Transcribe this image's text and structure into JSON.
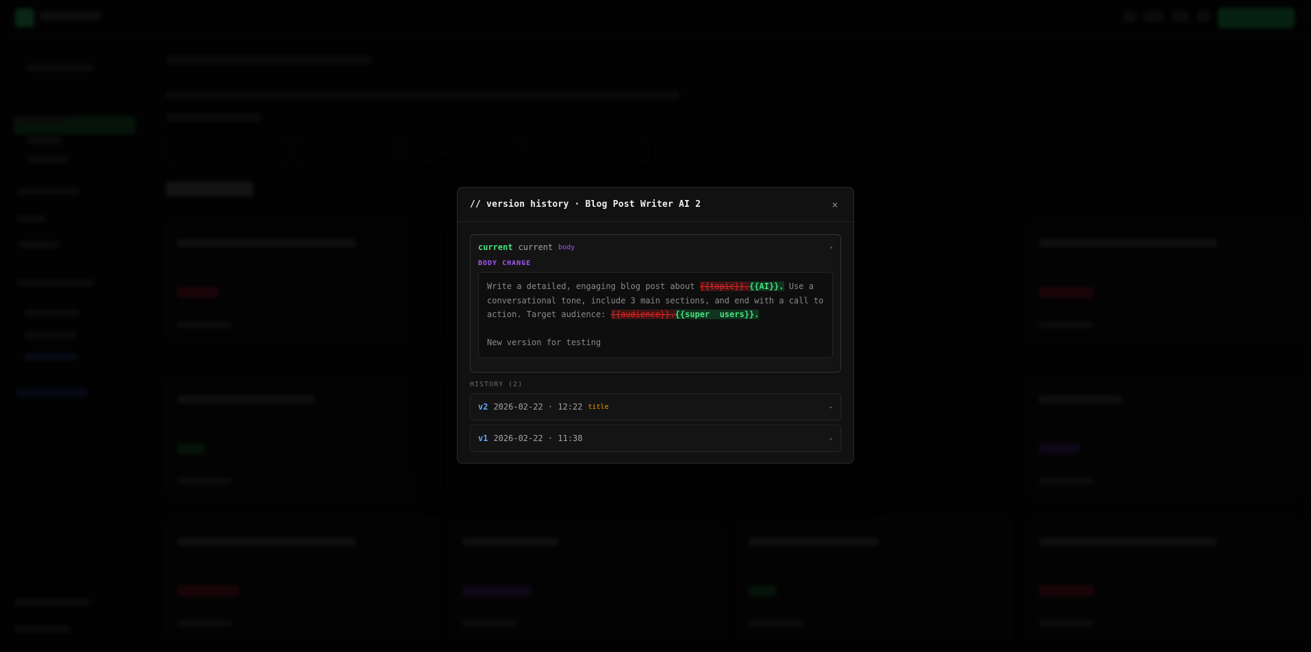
{
  "modal": {
    "title": "// version history · Blog Post Writer AI 2",
    "close_icon": "×",
    "current": {
      "label": "current",
      "sublabel": "current",
      "badge": "body",
      "chevron": "▾",
      "change_label": "BODY CHANGE",
      "text_before": "Write a detailed, engaging blog post about ",
      "del_1": "{{topic}}.",
      "add_1": "{{AI}}.",
      "text_middle": " Use a conversational tone, include 3 main sections, and end with a call to action. Target audience: ",
      "del_2": "{{audience}}.",
      "add_2": "{{super  users}}.",
      "note": "New version for testing"
    },
    "history": {
      "label": "HISTORY (2)",
      "items": [
        {
          "version": "v2",
          "date": "2026-02-22 · 12:22",
          "badge": "title",
          "chevron": "▸"
        },
        {
          "version": "v1",
          "date": "2026-02-22 · 11:38",
          "badge": "",
          "chevron": "▸"
        }
      ]
    }
  },
  "colors": {
    "accent_green": "#4ade80",
    "accent_purple": "#a855f7",
    "accent_blue": "#60a5fa",
    "accent_amber": "#f59e0b",
    "deletion_red": "#dc2626"
  },
  "icons": {
    "close": "close-icon",
    "expand": "chevron-down-icon",
    "row": "chevron-right-icon"
  }
}
